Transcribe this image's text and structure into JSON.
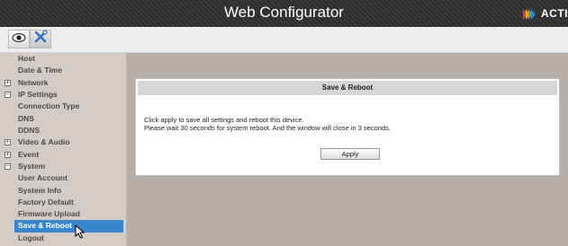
{
  "header": {
    "title": "Web Configurator",
    "brand": "ACTI"
  },
  "toolbar": {
    "buttons": [
      {
        "icon": "eye-icon"
      },
      {
        "icon": "tools-icon"
      }
    ]
  },
  "sidebar": {
    "items": [
      {
        "label": "Host"
      },
      {
        "label": "Date & Time"
      },
      {
        "label": "Network",
        "expander": "+"
      },
      {
        "label": "IP Settings",
        "expander": "−"
      },
      {
        "label": "Connection Type"
      },
      {
        "label": "DNS"
      },
      {
        "label": "DDNS"
      },
      {
        "label": "Video & Audio",
        "expander": "+"
      },
      {
        "label": "Event",
        "expander": "+"
      },
      {
        "label": "System",
        "expander": "−"
      },
      {
        "label": "User Account"
      },
      {
        "label": "System Info"
      },
      {
        "label": "Factory Default"
      },
      {
        "label": "Firmware Upload"
      },
      {
        "label": "Save & Reboot",
        "selected": true
      },
      {
        "label": "Logout"
      }
    ]
  },
  "panel": {
    "title": "Save & Reboot",
    "message_line1": "Click apply to save all settings and reboot this device.",
    "message_line2": "Please wait 30 seconds for system reboot. And the window will close in 3 seconds.",
    "apply_label": "Apply"
  },
  "colors": {
    "selected_bg": "#3a86cc",
    "sidebar_bg": "#d3ccc6",
    "content_bg": "#b5aea9"
  }
}
